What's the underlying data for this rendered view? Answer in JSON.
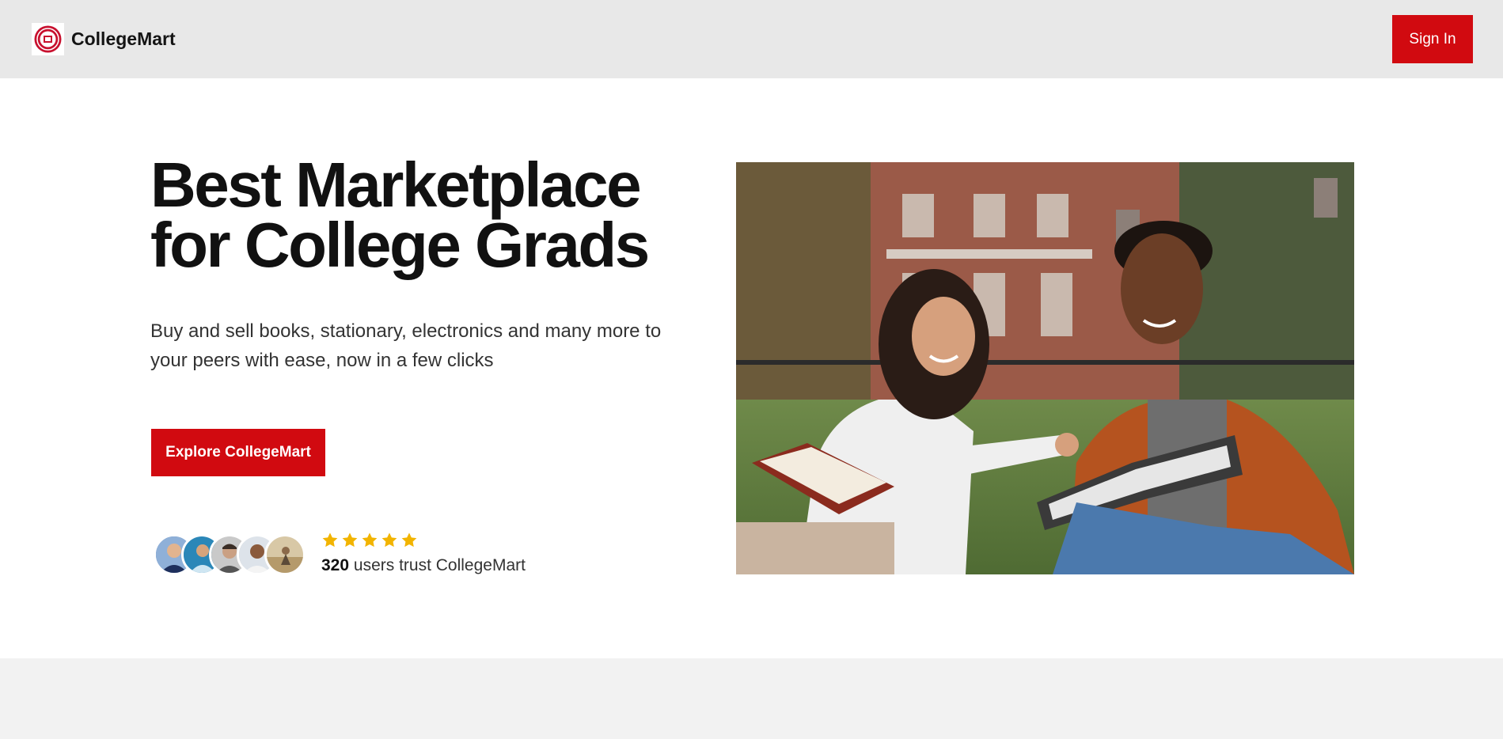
{
  "header": {
    "brand_name": "CollegeMart",
    "logo_icon": "college-seal-icon",
    "signin_label": "Sign In"
  },
  "hero": {
    "title_line1": "Best Marketplace",
    "title_line2": "for College Grads",
    "description": "Buy and sell books, stationary, electronics and many more to your peers with ease, now in a few clicks",
    "cta_label": "Explore CollegeMart",
    "social_proof": {
      "avatars": [
        "avatar-1",
        "avatar-2",
        "avatar-3",
        "avatar-4",
        "avatar-5"
      ],
      "rating_stars": 5,
      "user_count": "320",
      "trust_text": "users trust CollegeMart"
    },
    "image_icon": "students-studying-photo"
  },
  "colors": {
    "accent": "#d10a10",
    "navbar_bg": "#e8e8e8",
    "star": "#f2b400",
    "footer_bg": "#f2f2f2"
  }
}
